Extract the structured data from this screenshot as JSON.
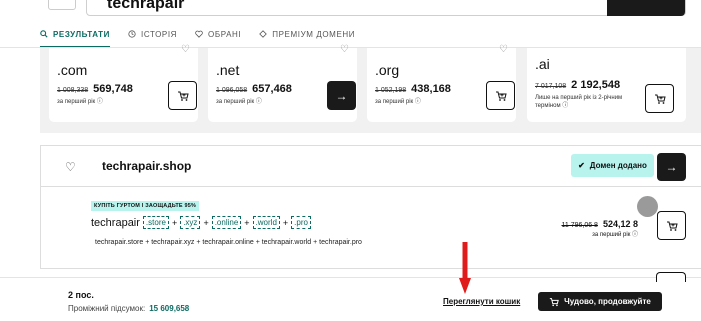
{
  "search": {
    "query": "techrapair"
  },
  "tabs": [
    {
      "label": "РЕЗУЛЬТАТИ",
      "icon": "search-icon"
    },
    {
      "label": "ІСТОРІЯ",
      "icon": "history-icon"
    },
    {
      "label": "ОБРАНІ",
      "icon": "heart-icon"
    },
    {
      "label": "ПРЕМІУМ ДОМЕНИ",
      "icon": "diamond-icon"
    }
  ],
  "cards": [
    {
      "tld": ".com",
      "old_price": "1 008,338",
      "price": "569,748",
      "note": "за перший рік",
      "action": "cart"
    },
    {
      "tld": ".net",
      "old_price": "1 096,058",
      "price": "657,468",
      "note": "за перший рік",
      "action": "arrow"
    },
    {
      "tld": ".org",
      "old_price": "1 052,198",
      "price": "438,168",
      "note": "за перший рік",
      "action": "cart"
    },
    {
      "tld": ".ai",
      "old_price": "7 017,108",
      "price": "2 192,548",
      "note": "Лише на перший рік із 2-річним терміном",
      "action": "cart"
    }
  ],
  "featured": {
    "domain": "techrapair.shop",
    "added_label": "Домен додано"
  },
  "bundle": {
    "tag": "КУПІТЬ ГУРТОМ І ЗАОЩАДЬТЕ 95%",
    "base": "techrapair",
    "extensions": [
      ".store",
      ".xyz",
      ".online",
      ".world",
      ".pro"
    ],
    "list": "techrapair.store + techrapair.xyz + techrapair.online + techrapair.world + techrapair.pro",
    "old_price": "11 796,06 8",
    "price": "524,12 8",
    "note": "за перший рік"
  },
  "footer": {
    "count": "2 пос.",
    "subtotal_label": "Проміжний підсумок:",
    "subtotal_value": "15 609,658",
    "view_cart": "Переглянути кошик",
    "continue": "Чудово, продовжуйте"
  },
  "colors": {
    "accent": "#0b6b62",
    "badge": "#b8f3ee",
    "dark": "#1a1a1a",
    "annotation": "#e01b1b"
  }
}
